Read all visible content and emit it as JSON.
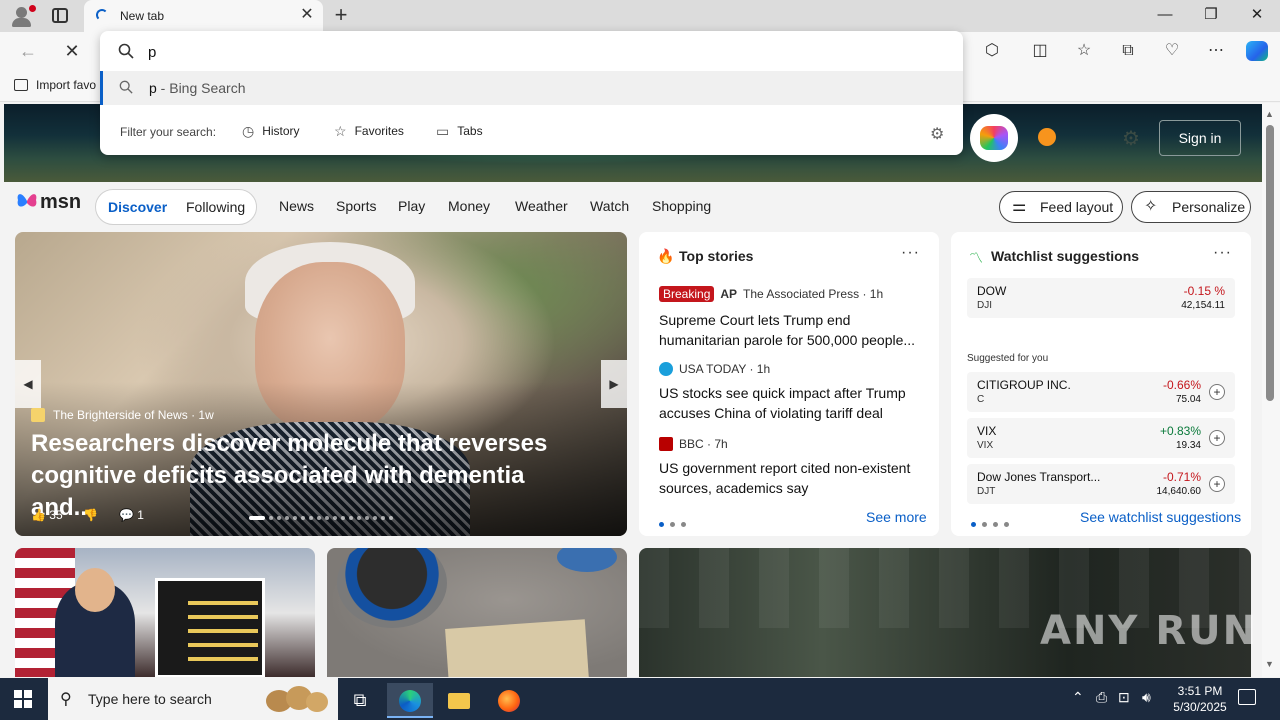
{
  "browser": {
    "tab_title": "New tab",
    "favorites_bar": {
      "import_label": "Import favo"
    }
  },
  "omnibox": {
    "value": "p",
    "suggestion": {
      "query": "p",
      "suffix": " - Bing Search"
    },
    "filter_label": "Filter your search:",
    "filters": [
      "History",
      "Favorites",
      "Tabs"
    ]
  },
  "msn": {
    "logo": "msn",
    "signin": "Sign in",
    "pills": [
      "Discover",
      "Following"
    ],
    "nav": [
      "News",
      "Sports",
      "Play",
      "Money",
      "Weather",
      "Watch",
      "Shopping"
    ],
    "feed_layout": "Feed layout",
    "personalize": "Personalize"
  },
  "hero": {
    "source": "The Brighterside of News",
    "age": "1w",
    "headline": "Researchers discover molecule that reverses cognitive deficits associated with dementia and...",
    "likes": "35",
    "comments": "1"
  },
  "top_stories": {
    "title": "Top stories",
    "items": [
      {
        "badge": "Breaking",
        "source": "The Associated Press · 1h",
        "headline": "Supreme Court lets Trump end humanitarian parole for 500,000 people..."
      },
      {
        "source": "USA TODAY · 1h",
        "headline": "US stocks see quick impact after Trump accuses China of violating tariff deal"
      },
      {
        "source": "BBC · 7h",
        "headline": "US government report cited non-existent sources, academics say"
      }
    ],
    "see_more": "See more"
  },
  "watchlist": {
    "title": "Watchlist suggestions",
    "main": {
      "name": "DOW",
      "ticker": "DJI",
      "change": "-0.15 %",
      "price": "42,154.11"
    },
    "suggested_label": "Suggested for you",
    "suggested": [
      {
        "name": "CITIGROUP INC.",
        "ticker": "C",
        "change": "-0.66%",
        "price": "75.04"
      },
      {
        "name": "VIX",
        "ticker": "VIX",
        "change": "+0.83%",
        "price": "19.34"
      },
      {
        "name": "Dow Jones Transport...",
        "ticker": "DJT",
        "change": "-0.71%",
        "price": "14,640.60"
      }
    ],
    "see_all": "See watchlist suggestions"
  },
  "watermark": "ANY RUN",
  "taskbar": {
    "search_placeholder": "Type here to search",
    "time": "3:51 PM",
    "date": "5/30/2025"
  }
}
